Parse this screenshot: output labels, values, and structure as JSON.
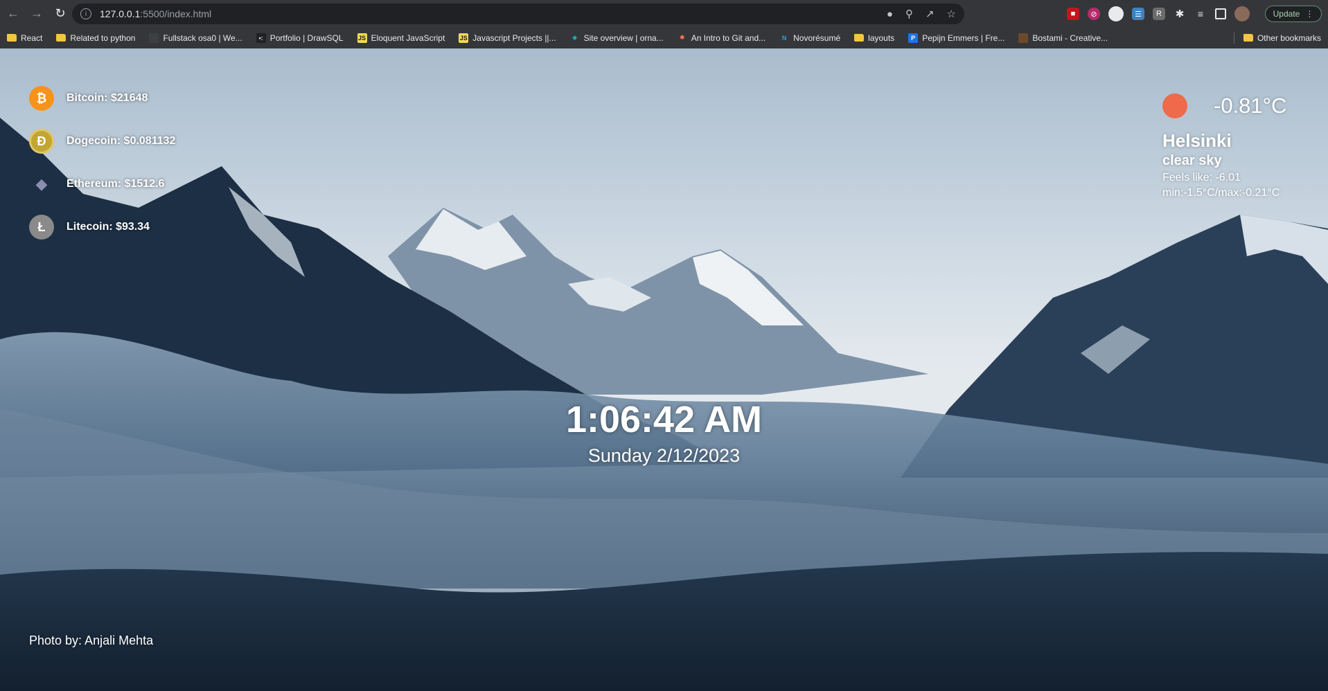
{
  "browser": {
    "url_host": "127.0.0.1",
    "url_path": ":5500/index.html",
    "update_label": "Update",
    "bookmarks": [
      {
        "label": "React",
        "icon": "folder-icon"
      },
      {
        "label": "Related to python",
        "icon": "folder-icon"
      },
      {
        "label": "Fullstack osa0 | We...",
        "icon": "page-icon"
      },
      {
        "label": "Portfolio | DrawSQL",
        "icon": "drawsql-icon"
      },
      {
        "label": "Eloquent JavaScript",
        "icon": "js-icon"
      },
      {
        "label": "Javascript Projects ||...",
        "icon": "js-icon"
      },
      {
        "label": "Site overview | orna...",
        "icon": "diamond-icon"
      },
      {
        "label": "An Intro to Git and...",
        "icon": "hubspot-icon"
      },
      {
        "label": "Novorésumé",
        "icon": "novoresume-icon"
      },
      {
        "label": "layouts",
        "icon": "folder-icon"
      },
      {
        "label": "Pepijn Emmers | Fre...",
        "icon": "pepijn-icon"
      },
      {
        "label": "Bostami - Creative...",
        "icon": "bostami-icon"
      }
    ],
    "other_bookmarks_label": "Other bookmarks"
  },
  "crypto": [
    {
      "name": "bitcoin",
      "text": "Bitcoin: $21648",
      "color": "#f7931a",
      "glyph": "₿"
    },
    {
      "name": "dogecoin",
      "text": "Dogecoin: $0.081132",
      "color": "#c2a633",
      "glyph": "Ð"
    },
    {
      "name": "ethereum",
      "text": "Ethereum: $1512.6",
      "color": "#6b6f8a",
      "glyph": "◆"
    },
    {
      "name": "litecoin",
      "text": "Litecoin: $93.34",
      "color": "#8a8a8a",
      "glyph": "Ł"
    }
  ],
  "weather": {
    "icon": "sun-icon",
    "temperature": "-0.81°C",
    "city": "Helsinki",
    "description": "clear sky",
    "feels_like": "Feels like: -6.01",
    "min_max": "min:-1.5°C/max:-0.21°C"
  },
  "clock": {
    "time": "1:06:42 AM",
    "date": "Sunday 2/12/2023"
  },
  "photo_credit": "Photo by: Anjali Mehta"
}
